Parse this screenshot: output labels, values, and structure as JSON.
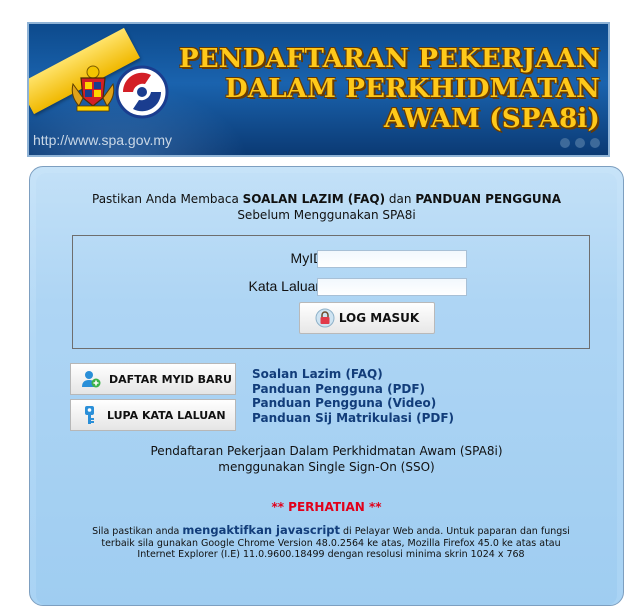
{
  "banner": {
    "title_line1": "PENDAFTARAN PEKERJAAN",
    "title_line2": "DALAM PERKHIDMATAN",
    "title_line3": "AWAM (SPA8i)",
    "url": "http://www.spa.gov.my",
    "crest_icon": "malaysia-coat-of-arms",
    "logo_icon": "spa-logo"
  },
  "notice": {
    "prefix": "Pastikan Anda Membaca ",
    "faq": "SOALAN LAZIM (FAQ)",
    "middle": " dan ",
    "guide": "PANDUAN PENGGUNA",
    "line2": "Sebelum Menggunakan SPA8i"
  },
  "login": {
    "myid_label": "MyID :",
    "myid_value": "",
    "password_label": "Kata Laluan :",
    "password_value": "",
    "login_button": "LOG MASUK"
  },
  "side_buttons": {
    "register": "DAFTAR MYID BARU",
    "forgot": "LUPA KATA LALUAN"
  },
  "links": [
    "Soalan Lazim (FAQ)",
    "Panduan Pengguna (PDF)",
    "Panduan Pengguna (Video)",
    "Panduan Sij Matrikulasi (PDF)"
  ],
  "sso": {
    "line1": "Pendaftaran Pekerjaan Dalam Perkhidmatan Awam (SPA8i)",
    "line2": "menggunakan Single Sign-On (SSO)"
  },
  "attention": "** PERHATIAN **",
  "browser_note": {
    "prefix": "Sila pastikan anda ",
    "emphasis": "mengaktifkan javascript",
    "rest_line1": " di Pelayar Web anda. Untuk paparan dan fungsi",
    "line2": "terbaik sila gunakan Google Chrome Version 48.0.2564 ke atas, Mozilla Firefox 45.0 ke atas atau",
    "line3": "Internet Explorer (I.E) 11.0.9600.18499 dengan resolusi minima skrin 1024 x 768"
  },
  "colors": {
    "banner_blue": "#0d4a8c",
    "title_gold": "#ffc91a",
    "link_blue": "#123d7a",
    "attention_red": "#e1001a",
    "panel_blue": "#aed5f4"
  }
}
